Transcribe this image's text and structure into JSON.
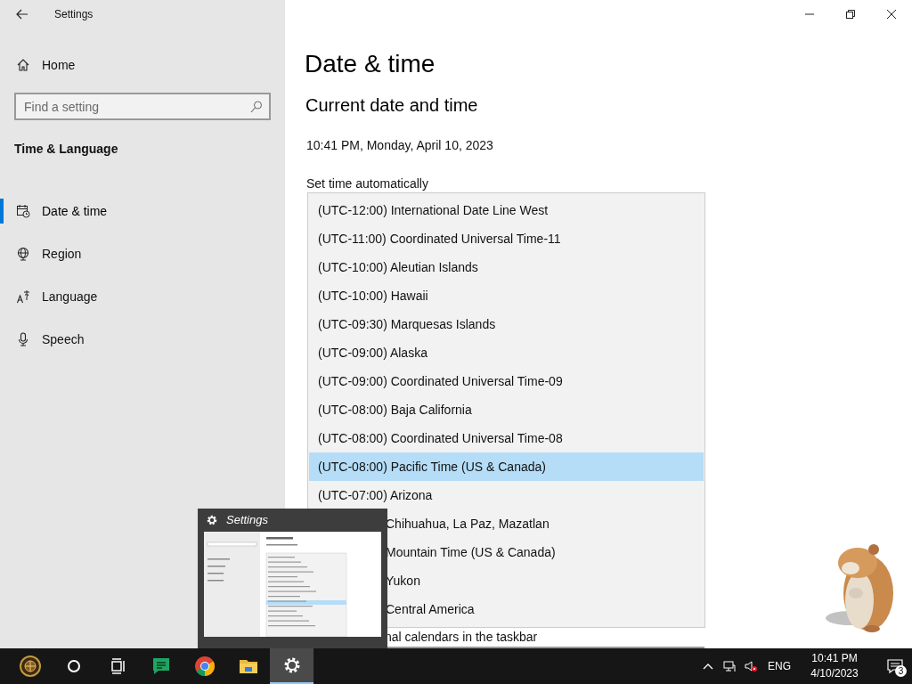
{
  "window": {
    "title": "Settings"
  },
  "sidebar": {
    "home": "Home",
    "search_placeholder": "Find a setting",
    "section": "Time & Language",
    "items": [
      {
        "label": "Date & time",
        "kind": "calendar",
        "selected": true
      },
      {
        "label": "Region",
        "kind": "globe",
        "selected": false
      },
      {
        "label": "Language",
        "kind": "language",
        "selected": false
      },
      {
        "label": "Speech",
        "kind": "microphone",
        "selected": false
      }
    ]
  },
  "page": {
    "title": "Date & time",
    "subtitle": "Current date and time",
    "current": "10:41 PM, Monday, April 10, 2023",
    "set_time_label": "Set time automatically",
    "partial_label": "nal calendars in the taskbar"
  },
  "timezone_list": {
    "items": [
      {
        "label": "(UTC-12:00) International Date Line West",
        "selected": false,
        "covered": false
      },
      {
        "label": "(UTC-11:00) Coordinated Universal Time-11",
        "selected": false,
        "covered": false
      },
      {
        "label": "(UTC-10:00) Aleutian Islands",
        "selected": false,
        "covered": false
      },
      {
        "label": "(UTC-10:00) Hawaii",
        "selected": false,
        "covered": false
      },
      {
        "label": "(UTC-09:30) Marquesas Islands",
        "selected": false,
        "covered": false
      },
      {
        "label": "(UTC-09:00) Alaska",
        "selected": false,
        "covered": false
      },
      {
        "label": "(UTC-09:00) Coordinated Universal Time-09",
        "selected": false,
        "covered": false
      },
      {
        "label": "(UTC-08:00) Baja California",
        "selected": false,
        "covered": false
      },
      {
        "label": "(UTC-08:00) Coordinated Universal Time-08",
        "selected": false,
        "covered": false
      },
      {
        "label": "(UTC-08:00) Pacific Time (US & Canada)",
        "selected": true,
        "covered": false
      },
      {
        "label": "(UTC-07:00) Arizona",
        "selected": false,
        "covered": false
      },
      {
        "label": "Chihuahua, La Paz, Mazatlan",
        "selected": false,
        "covered": true
      },
      {
        "label": "Mountain Time (US & Canada)",
        "selected": false,
        "covered": true
      },
      {
        "label": "Yukon",
        "selected": false,
        "covered": true
      },
      {
        "label": "Central America",
        "selected": false,
        "covered": true
      }
    ]
  },
  "thumbnail": {
    "title": "Settings"
  },
  "taskbar": {
    "apps": [
      {
        "kind": "start",
        "active": false
      },
      {
        "kind": "search",
        "active": false
      },
      {
        "kind": "taskview",
        "active": false
      },
      {
        "kind": "chat",
        "active": false
      },
      {
        "kind": "browser",
        "active": false
      },
      {
        "kind": "folder",
        "active": false
      },
      {
        "kind": "settings",
        "active": true
      }
    ],
    "language": "ENG",
    "time": "10:41 PM",
    "date": "4/10/2023",
    "notifications": "3"
  }
}
